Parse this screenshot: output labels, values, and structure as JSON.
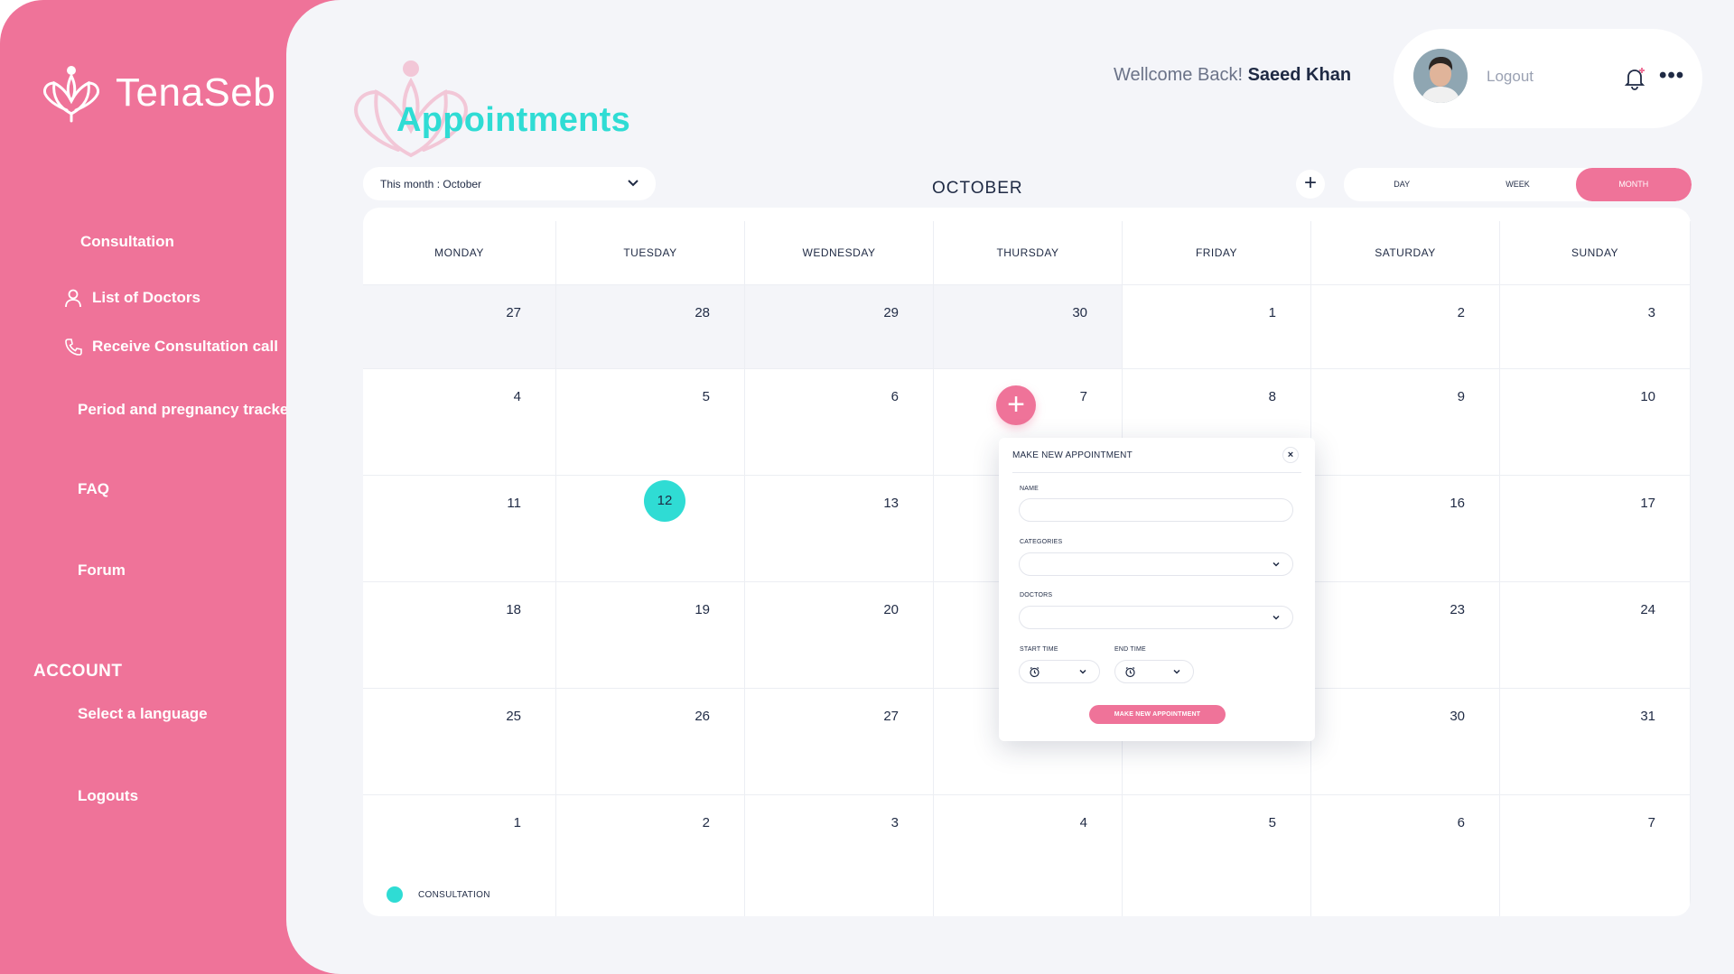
{
  "app": {
    "name": "TenaSeb"
  },
  "colors": {
    "brand_pink": "#ef7399",
    "accent_teal": "#2fdcd4",
    "background": "#f4f5f9"
  },
  "sidebar": {
    "items": [
      {
        "label": "Consultation",
        "icon": null
      },
      {
        "label": "List of Doctors",
        "icon": "person-icon"
      },
      {
        "label": "Receive Consultation call",
        "icon": "phone-icon"
      },
      {
        "label": "Period and pregnancy tracker",
        "icon": null
      },
      {
        "label": "FAQ",
        "icon": null
      },
      {
        "label": "Forum",
        "icon": null
      }
    ],
    "account_title": "ACCOUNT",
    "account_items": [
      {
        "label": "Select a language"
      },
      {
        "label": "Logouts"
      }
    ]
  },
  "header": {
    "page_title": "Appointments",
    "welcome_prefix": "Wellcome Back!",
    "user_name": "Saeed Khan",
    "logout_label": "Logout"
  },
  "toolbar": {
    "month_select": "This month : October",
    "month_label": "OCTOBER",
    "add_symbol": "+",
    "views": [
      "DAY",
      "WEEK",
      "MONTH"
    ],
    "active_view": "MONTH"
  },
  "calendar": {
    "weekdays": [
      "MONDAY",
      "TUESDAY",
      "WEDNESDAY",
      "THURSDAY",
      "FRIDAY",
      "SATURDAY",
      "SUNDAY"
    ],
    "weeks": [
      [
        "27",
        "28",
        "29",
        "30",
        "1",
        "2",
        "3"
      ],
      [
        "4",
        "5",
        "6",
        "7",
        "8",
        "9",
        "10"
      ],
      [
        "11",
        "12",
        "13",
        "",
        "",
        "16",
        "17"
      ],
      [
        "18",
        "19",
        "20",
        "",
        "",
        "23",
        "24"
      ],
      [
        "25",
        "26",
        "27",
        "",
        "",
        "30",
        "31"
      ],
      [
        "1",
        "2",
        "3",
        "4",
        "5",
        "6",
        "7"
      ]
    ],
    "today": "12"
  },
  "legend": {
    "label": "CONSULTATION"
  },
  "popup": {
    "title": "MAKE NEW APPOINTMENT",
    "close_symbol": "×",
    "name_label": "NAME",
    "categories_label": "CATEGORIES",
    "doctors_label": "DOCTORS",
    "start_time_label": "START TIME",
    "end_time_label": "END TIME",
    "submit_label": "MAKE NEW APPOINTMENT"
  }
}
